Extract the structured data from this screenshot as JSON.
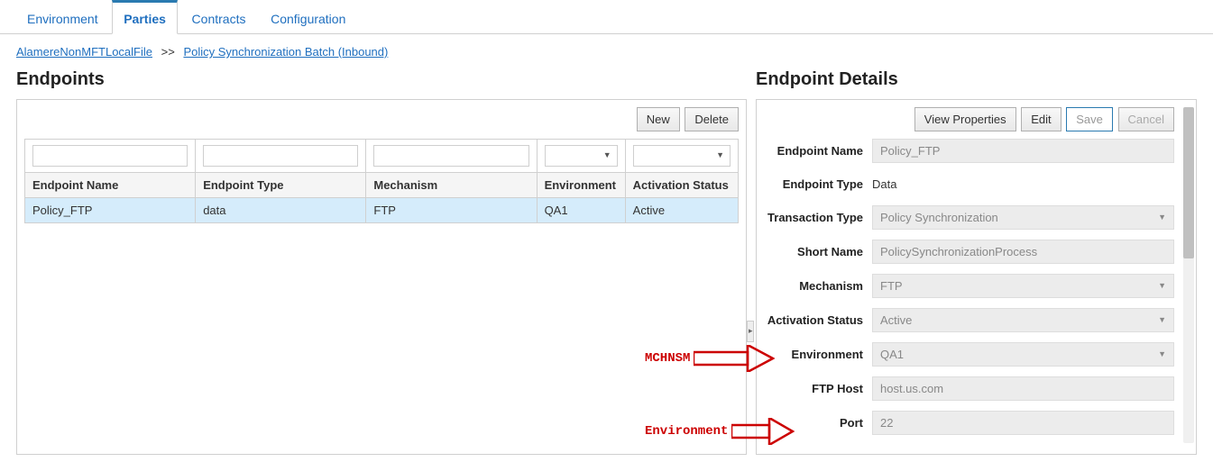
{
  "tabs": {
    "environment": "Environment",
    "parties": "Parties",
    "contracts": "Contracts",
    "configuration": "Configuration"
  },
  "breadcrumb": {
    "root": "AlamereNonMFTLocalFile",
    "sep": ">>",
    "leaf": "Policy Synchronization Batch (Inbound)"
  },
  "left": {
    "title": "Endpoints",
    "new_btn": "New",
    "delete_btn": "Delete",
    "columns": {
      "name": "Endpoint Name",
      "type": "Endpoint Type",
      "mechanism": "Mechanism",
      "environment": "Environment",
      "activation": "Activation Status"
    },
    "rows": [
      {
        "name": "Policy_FTP",
        "type": "data",
        "mechanism": "FTP",
        "environment": "QA1",
        "activation": "Active"
      }
    ]
  },
  "right": {
    "title": "Endpoint Details",
    "btn_view": "View Properties",
    "btn_edit": "Edit",
    "btn_save": "Save",
    "btn_cancel": "Cancel",
    "labels": {
      "endpoint_name": "Endpoint Name",
      "endpoint_type": "Endpoint Type",
      "transaction_type": "Transaction Type",
      "short_name": "Short Name",
      "mechanism": "Mechanism",
      "activation_status": "Activation Status",
      "environment": "Environment",
      "ftp_host": "FTP Host",
      "port": "Port"
    },
    "values": {
      "endpoint_name": "Policy_FTP",
      "endpoint_type": "Data",
      "transaction_type": "Policy Synchronization",
      "short_name": "PolicySynchronizationProcess",
      "mechanism": "FTP",
      "activation_status": "Active",
      "environment": "QA1",
      "ftp_host": "host.us.com",
      "port": "22"
    }
  },
  "annotations": {
    "mechanism": "MCHNSM",
    "environment": "Environment"
  }
}
